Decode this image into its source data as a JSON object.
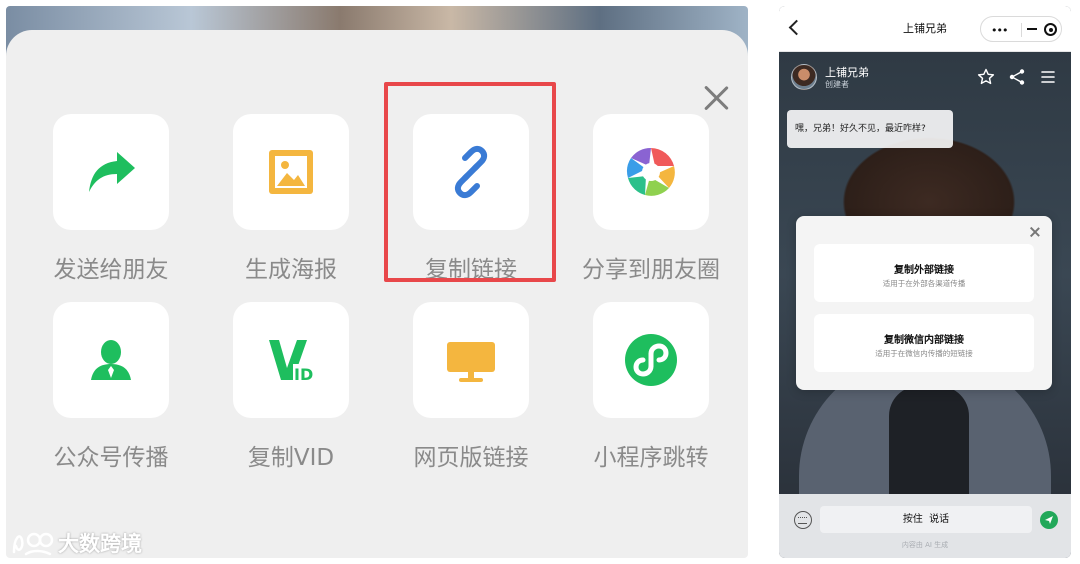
{
  "share_sheet": {
    "items": [
      {
        "label": "发送给朋友",
        "icon": "share-forward-icon"
      },
      {
        "label": "生成海报",
        "icon": "poster-image-icon"
      },
      {
        "label": "复制链接",
        "icon": "link-icon"
      },
      {
        "label": "分享到朋友圈",
        "icon": "moments-icon"
      },
      {
        "label": "公众号传播",
        "icon": "official-account-icon"
      },
      {
        "label": "复制VID",
        "icon": "vid-icon"
      },
      {
        "label": "网页版链接",
        "icon": "monitor-icon"
      },
      {
        "label": "小程序跳转",
        "icon": "mini-program-icon"
      }
    ],
    "highlighted_item": "复制链接",
    "close_icon": "close-icon"
  },
  "watermark": {
    "text": "大数跨境"
  },
  "phone": {
    "title": "上铺兄弟",
    "capsule": {
      "more": "•••"
    },
    "character": {
      "name": "上铺兄弟",
      "role": "创建者"
    },
    "message": "嘿，兄弟！好久不见，最近咋样?",
    "link_modal": {
      "options": [
        {
          "title": "复制外部链接",
          "subtitle": "适用于在外部各渠道传播"
        },
        {
          "title": "复制微信内部链接",
          "subtitle": "适用于在微信内传播的短链接"
        }
      ]
    },
    "input": {
      "talk_label": "按住  说话"
    },
    "ai_note": "内容由 AI 生成"
  },
  "colors": {
    "wechat_green": "#1ebe5e",
    "highlight_red": "#e8474a",
    "link_blue": "#3a7bd5",
    "poster_orange": "#f4b63f"
  }
}
